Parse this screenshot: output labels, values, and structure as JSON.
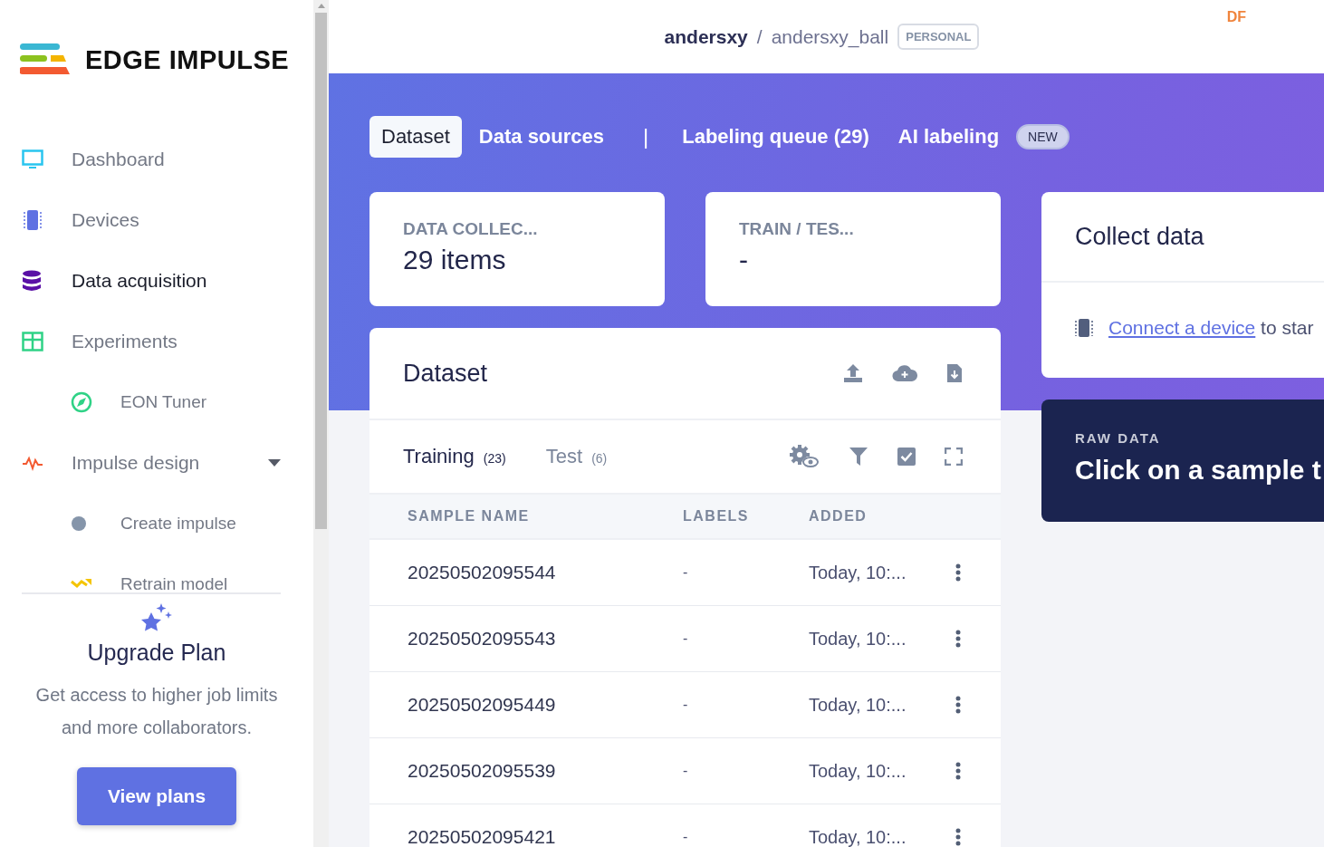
{
  "brand": {
    "name": "EDGE IMPULSE"
  },
  "sidebar": {
    "items": [
      {
        "kind": "monitor",
        "label": "Dashboard",
        "selected": false,
        "sub": false
      },
      {
        "kind": "chip",
        "label": "Devices",
        "selected": false,
        "sub": false
      },
      {
        "kind": "database",
        "label": "Data acquisition",
        "selected": true,
        "sub": false
      },
      {
        "kind": "grid",
        "label": "Experiments",
        "selected": false,
        "sub": false
      },
      {
        "kind": "compass",
        "label": "EON Tuner",
        "selected": false,
        "sub": true
      },
      {
        "kind": "pulse",
        "label": "Impulse design",
        "selected": false,
        "sub": false,
        "expanded": true
      },
      {
        "kind": "dot",
        "label": "Create impulse",
        "selected": false,
        "sub": true
      },
      {
        "kind": "trend",
        "label": "Retrain model",
        "selected": false,
        "sub": true
      }
    ]
  },
  "upgrade": {
    "title": "Upgrade Plan",
    "text": "Get access to higher job limits and more collaborators.",
    "button": "View plans"
  },
  "header": {
    "owner": "andersxy",
    "separator": "/",
    "project": "andersxy_ball",
    "badge": "PERSONAL",
    "user": "DF"
  },
  "tabs": [
    {
      "label": "Dataset",
      "selected": true
    },
    {
      "label": "Data sources",
      "selected": false
    },
    {
      "kind": "divider",
      "label": "|"
    },
    {
      "label": "Labeling queue (29)",
      "selected": false
    },
    {
      "label": "AI labeling",
      "selected": false,
      "badge": "NEW"
    }
  ],
  "stats": [
    {
      "title": "DATA COLLEC...",
      "value": "29 items"
    },
    {
      "title": "TRAIN / TES...",
      "value": "-"
    }
  ],
  "dataset": {
    "title": "Dataset",
    "subtabs": [
      {
        "label": "Training",
        "count": "(23)",
        "selected": true
      },
      {
        "label": "Test",
        "count": "(6)",
        "selected": false
      }
    ],
    "columns": [
      "SAMPLE NAME",
      "LABELS",
      "ADDED"
    ],
    "rows": [
      {
        "name": "20250502095544",
        "labels": "-",
        "added": "Today, 10:..."
      },
      {
        "name": "20250502095543",
        "labels": "-",
        "added": "Today, 10:..."
      },
      {
        "name": "20250502095449",
        "labels": "-",
        "added": "Today, 10:..."
      },
      {
        "name": "20250502095539",
        "labels": "-",
        "added": "Today, 10:..."
      },
      {
        "name": "20250502095421",
        "labels": "-",
        "added": "Today, 10:..."
      }
    ]
  },
  "collect": {
    "title": "Collect data",
    "link": "Connect a device",
    "text": "to star"
  },
  "raw_data": {
    "label": "RAW DATA",
    "text": "Click on a sample t"
  }
}
